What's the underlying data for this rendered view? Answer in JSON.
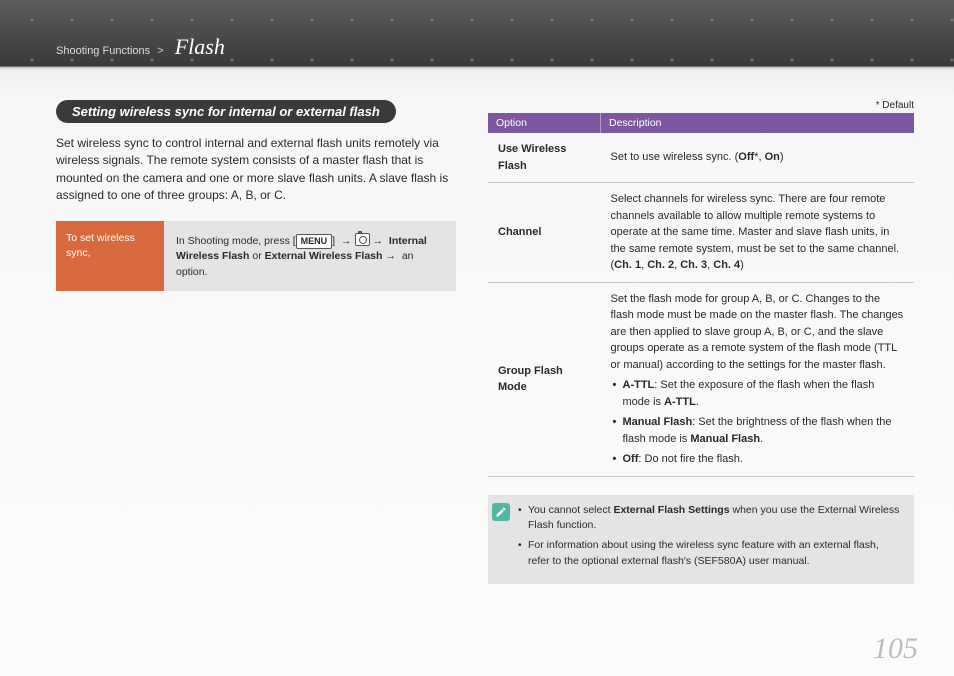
{
  "header": {
    "section": "Shooting Functions",
    "separator": ">",
    "topic": "Flash"
  },
  "left": {
    "heading": "Setting wireless sync for internal or external flash",
    "intro": "Set wireless sync to control internal and external flash units remotely via wireless signals. The remote system consists of a master flash that is mounted on the camera and one or more slave flash units. A slave flash is assigned to one of three groups: A, B, or C.",
    "step_label": "To set wireless sync,",
    "step_pre": "In Shooting mode, press [",
    "step_menu": "MENU",
    "step_mid1": "] ",
    "step_arrow": "→",
    "step_mid2": " ",
    "step_tail1": " ",
    "step_link1": "Internal Wireless Flash",
    "step_or": " or ",
    "step_link2": "External Wireless Flash",
    "step_tail2": " an option."
  },
  "right": {
    "default_note": "* Default",
    "th_option": "Option",
    "th_desc": "Description",
    "rows": [
      {
        "name": "Use Wireless Flash",
        "desc_pre": "Set to use wireless sync. (",
        "opt1": "Off",
        "star": "*",
        "sep": ", ",
        "opt2": "On",
        "desc_post": ")"
      },
      {
        "name": "Channel",
        "desc_pre": "Select channels for wireless sync. There are four remote channels available to allow multiple remote systems to operate at the same time. Master and slave flash units, in the same remote system, must be set to the same channel. (",
        "c1": "Ch. 1",
        "s1": ", ",
        "c2": "Ch. 2",
        "s2": ", ",
        "c3": "Ch. 3",
        "s3": ", ",
        "c4": "Ch. 4",
        "desc_post": ")"
      },
      {
        "name": "Group Flash Mode",
        "desc": "Set the flash mode for group A, B, or C. Changes to the flash mode must be made on the master flash. The changes are then applied to slave group A, B, or C, and the slave groups operate as a remote system of the flash mode (TTL or manual) according to the settings for the master flash.",
        "b1_label": "A-TTL",
        "b1_pre": ": Set the exposure of the flash when the flash mode is ",
        "b1_val": "A-TTL",
        "b1_post": ".",
        "b2_label": "Manual Flash",
        "b2_pre": ": Set the brightness of the flash when the flash mode is ",
        "b2_val": "Manual Flash",
        "b2_post": ".",
        "b3_label": "Off",
        "b3_text": ": Do not fire the flash."
      }
    ],
    "note": {
      "n1_pre": "You cannot select ",
      "n1_bold": "External Flash Settings",
      "n1_post": " when you use the External Wireless Flash function.",
      "n2": "For information about using the wireless sync feature with an external flash, refer to the optional external flash's (SEF580A) user manual."
    }
  },
  "page_number": "105"
}
